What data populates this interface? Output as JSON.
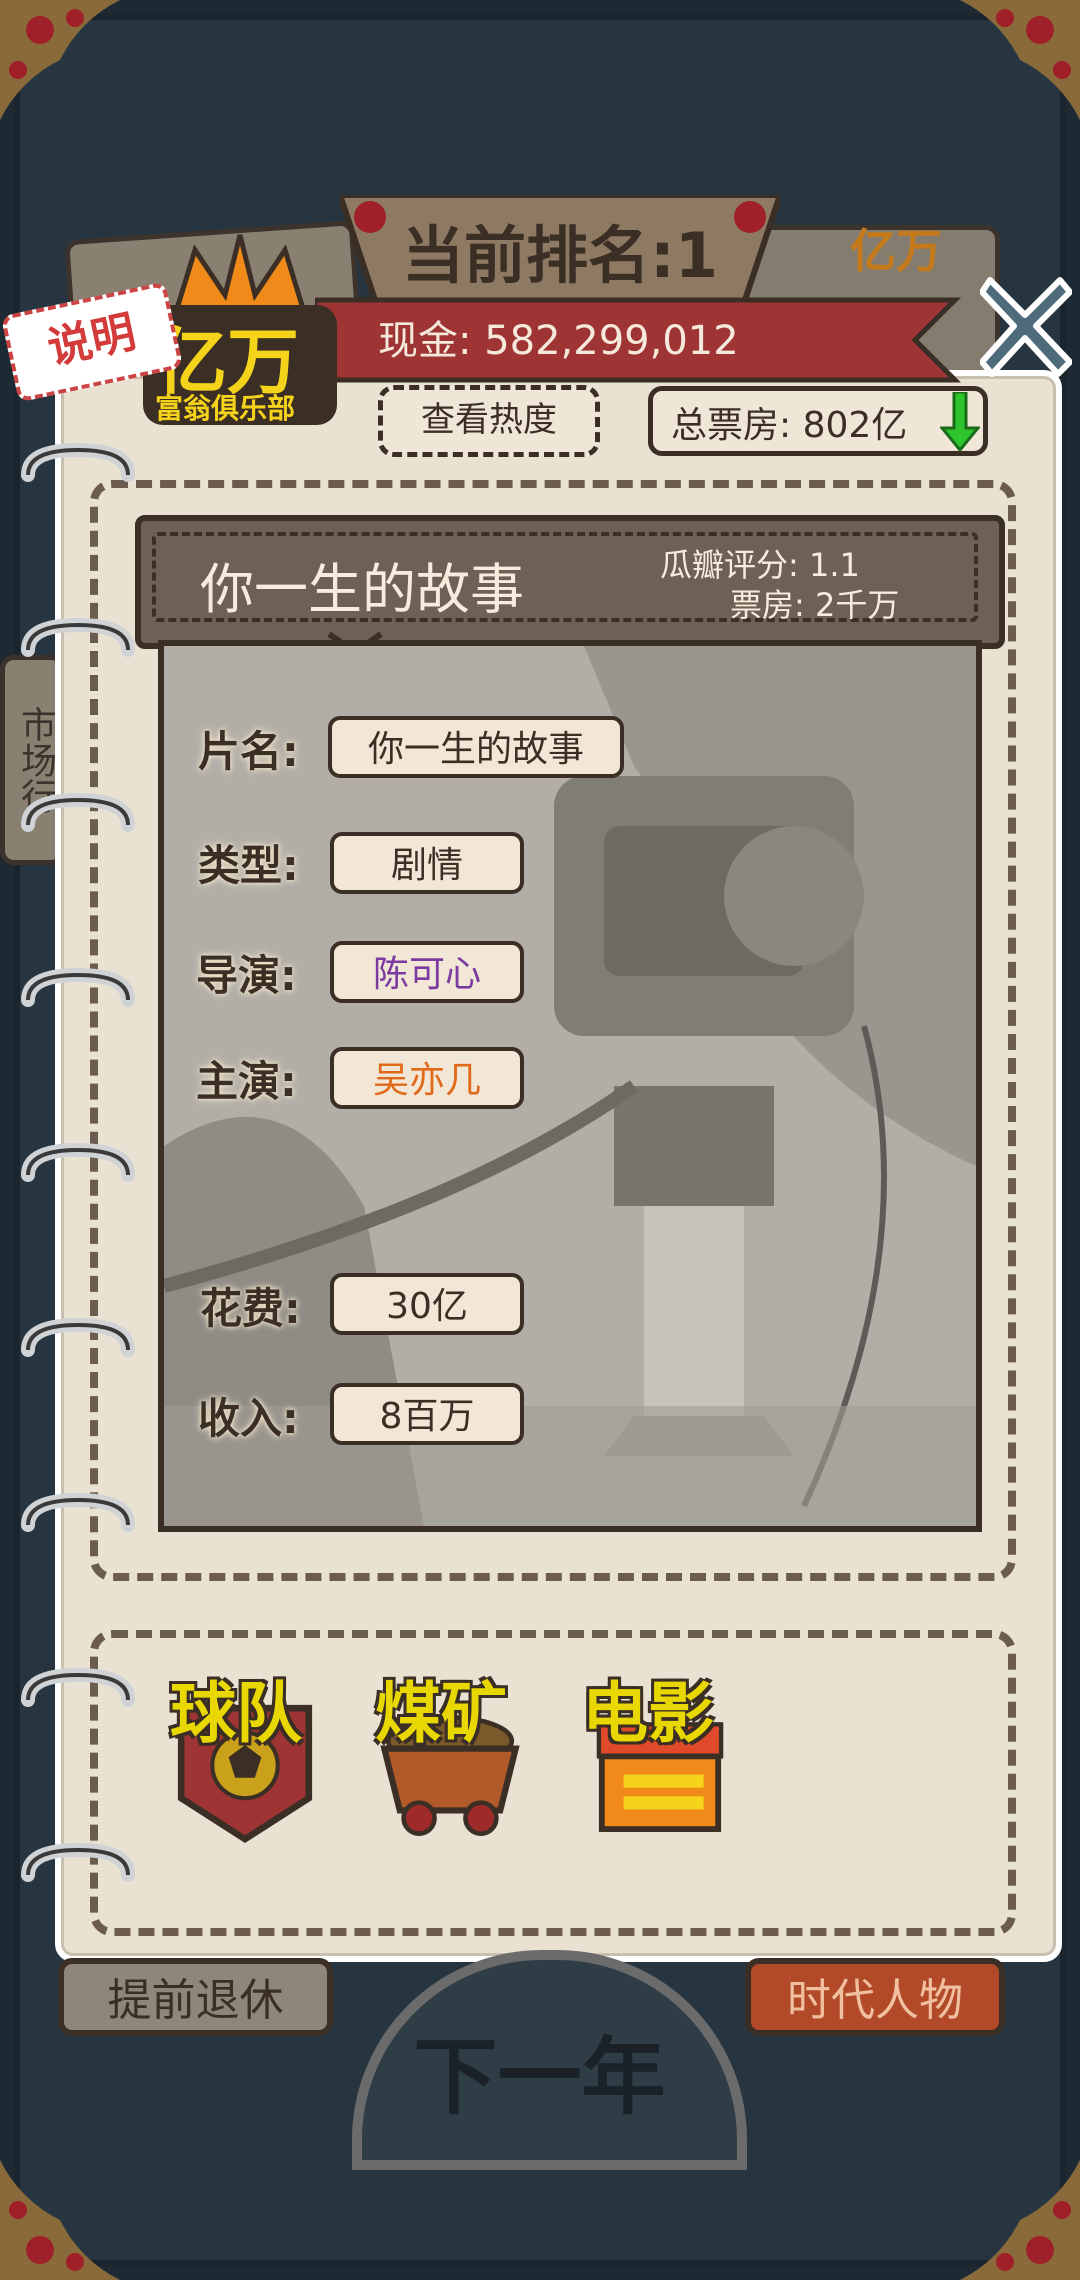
{
  "header": {
    "rank_label": "当前排名:1",
    "cash_label": "现金: 582,299,012",
    "view_heat_label": "查看热度",
    "total_boxoffice_label": "总票房: 802亿",
    "help_label": "说明",
    "logo_main": "亿万",
    "logo_sub": "富翁俱乐部",
    "background_logo": "亿万",
    "side_tab": "市场行"
  },
  "film": {
    "title": "你一生的故事",
    "score_label": "瓜瓣评分: 1.1",
    "boxoffice_label": "票房: 2千万",
    "fields": [
      {
        "label": "片名:",
        "value": "你一生的故事",
        "color": "#3a2e25"
      },
      {
        "label": "类型:",
        "value": "剧情",
        "color": "#3a2e25"
      },
      {
        "label": "导演:",
        "value": "陈可心",
        "color": "#7a3aa0"
      },
      {
        "label": "主演:",
        "value": "吴亦几",
        "color": "#e06a1a"
      },
      {
        "label": "花费:",
        "value": "30亿",
        "color": "#3a2e25"
      },
      {
        "label": "收入:",
        "value": "8百万",
        "color": "#3a2e25"
      }
    ]
  },
  "industries": {
    "team": "球队",
    "coal": "煤矿",
    "movie": "电影"
  },
  "footer": {
    "retire": "提前退休",
    "next_year": "下一年",
    "era_people": "时代人物"
  },
  "colors": {
    "ribbon_red": "#9e3434",
    "director_purple": "#7a3aa0",
    "actor_orange": "#e06a1a",
    "industry_yellow": "#e8d700"
  }
}
